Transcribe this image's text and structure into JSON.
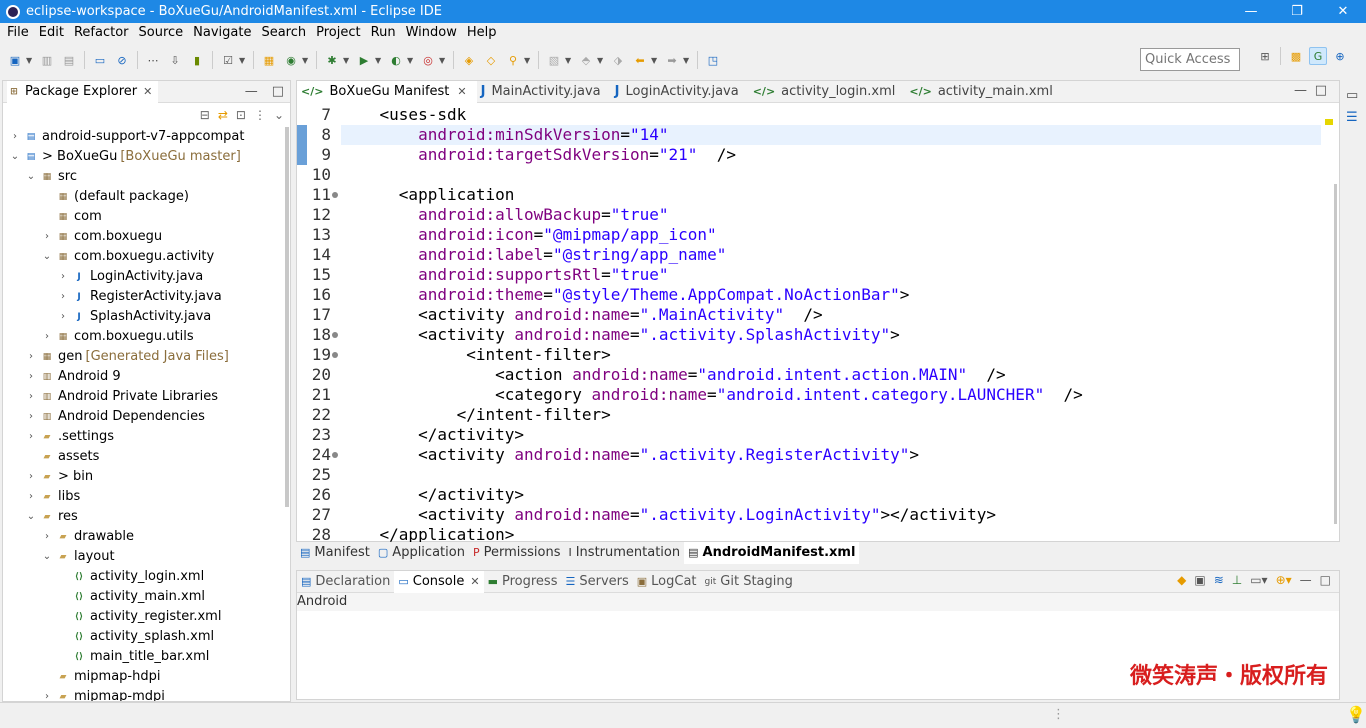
{
  "window": {
    "title": "eclipse-workspace - BoXueGu/AndroidManifest.xml - Eclipse IDE"
  },
  "menu": [
    "File",
    "Edit",
    "Refactor",
    "Source",
    "Navigate",
    "Search",
    "Project",
    "Run",
    "Window",
    "Help"
  ],
  "quick_access": {
    "placeholder": "Quick Access"
  },
  "package_explorer": {
    "tab_label": "Package Explorer",
    "tree": [
      {
        "label": "android-support-v7-appcompat",
        "deco": "",
        "depth": 0,
        "twisty": "closed",
        "icon": "project-icon"
      },
      {
        "label": "> BoXueGu",
        "deco": "[BoXueGu master]",
        "depth": 0,
        "twisty": "open",
        "icon": "project-icon"
      },
      {
        "label": "src",
        "deco": "",
        "depth": 1,
        "twisty": "open",
        "icon": "source-folder-icon"
      },
      {
        "label": "(default package)",
        "deco": "",
        "depth": 2,
        "twisty": "none",
        "icon": "package-icon"
      },
      {
        "label": "com",
        "deco": "",
        "depth": 2,
        "twisty": "none",
        "icon": "package-icon"
      },
      {
        "label": "com.boxuegu",
        "deco": "",
        "depth": 2,
        "twisty": "closed",
        "icon": "package-icon"
      },
      {
        "label": "com.boxuegu.activity",
        "deco": "",
        "depth": 2,
        "twisty": "open",
        "icon": "package-icon"
      },
      {
        "label": "LoginActivity.java",
        "deco": "",
        "depth": 3,
        "twisty": "closed",
        "icon": "java-file-icon"
      },
      {
        "label": "RegisterActivity.java",
        "deco": "",
        "depth": 3,
        "twisty": "closed",
        "icon": "java-file-icon"
      },
      {
        "label": "SplashActivity.java",
        "deco": "",
        "depth": 3,
        "twisty": "closed",
        "icon": "java-file-icon"
      },
      {
        "label": "com.boxuegu.utils",
        "deco": "",
        "depth": 2,
        "twisty": "closed",
        "icon": "package-icon"
      },
      {
        "label": "gen",
        "deco": "[Generated Java Files]",
        "depth": 1,
        "twisty": "closed",
        "icon": "source-folder-icon"
      },
      {
        "label": "Android 9",
        "deco": "",
        "depth": 1,
        "twisty": "closed",
        "icon": "library-icon"
      },
      {
        "label": "Android Private Libraries",
        "deco": "",
        "depth": 1,
        "twisty": "closed",
        "icon": "library-icon"
      },
      {
        "label": "Android Dependencies",
        "deco": "",
        "depth": 1,
        "twisty": "closed",
        "icon": "library-icon"
      },
      {
        "label": ".settings",
        "deco": "",
        "depth": 1,
        "twisty": "closed",
        "icon": "folder-icon"
      },
      {
        "label": "assets",
        "deco": "",
        "depth": 1,
        "twisty": "none",
        "icon": "folder-icon"
      },
      {
        "label": "> bin",
        "deco": "",
        "depth": 1,
        "twisty": "closed",
        "icon": "folder-icon"
      },
      {
        "label": "libs",
        "deco": "",
        "depth": 1,
        "twisty": "closed",
        "icon": "folder-icon"
      },
      {
        "label": "res",
        "deco": "",
        "depth": 1,
        "twisty": "open",
        "icon": "folder-icon"
      },
      {
        "label": "drawable",
        "deco": "",
        "depth": 2,
        "twisty": "closed",
        "icon": "folder-icon"
      },
      {
        "label": "layout",
        "deco": "",
        "depth": 2,
        "twisty": "open",
        "icon": "folder-icon"
      },
      {
        "label": "activity_login.xml",
        "deco": "",
        "depth": 3,
        "twisty": "none",
        "icon": "xml-file-icon"
      },
      {
        "label": "activity_main.xml",
        "deco": "",
        "depth": 3,
        "twisty": "none",
        "icon": "xml-file-icon"
      },
      {
        "label": "activity_register.xml",
        "deco": "",
        "depth": 3,
        "twisty": "none",
        "icon": "xml-file-icon"
      },
      {
        "label": "activity_splash.xml",
        "deco": "",
        "depth": 3,
        "twisty": "none",
        "icon": "xml-file-icon"
      },
      {
        "label": "main_title_bar.xml",
        "deco": "",
        "depth": 3,
        "twisty": "none",
        "icon": "xml-file-icon"
      },
      {
        "label": "mipmap-hdpi",
        "deco": "",
        "depth": 2,
        "twisty": "none",
        "icon": "folder-icon"
      },
      {
        "label": "mipmap-mdpi",
        "deco": "",
        "depth": 2,
        "twisty": "closed",
        "icon": "folder-icon"
      }
    ]
  },
  "editor_tabs": [
    {
      "label": "BoXueGu Manifest",
      "active": true,
      "icon": "xml-icon"
    },
    {
      "label": "MainActivity.java",
      "active": false,
      "icon": "java-icon"
    },
    {
      "label": "LoginActivity.java",
      "active": false,
      "icon": "java-icon"
    },
    {
      "label": "activity_login.xml",
      "active": false,
      "icon": "xml-icon"
    },
    {
      "label": "activity_main.xml",
      "active": false,
      "icon": "xml-icon"
    }
  ],
  "code_lines": [
    {
      "n": "7",
      "fold": false,
      "parts": [
        [
          "tg",
          "    <uses-sdk"
        ]
      ]
    },
    {
      "n": "8",
      "fold": false,
      "parts": [
        [
          "at",
          "        android:minSdkVersion"
        ],
        [
          "tg",
          "="
        ],
        [
          "sv",
          "\"14\""
        ]
      ]
    },
    {
      "n": "9",
      "fold": false,
      "parts": [
        [
          "at",
          "        android:targetSdkVersion"
        ],
        [
          "tg",
          "="
        ],
        [
          "sv",
          "\"21\""
        ],
        [
          "tg",
          "  />"
        ]
      ]
    },
    {
      "n": "10",
      "fold": false,
      "parts": [
        [
          "tg",
          ""
        ]
      ]
    },
    {
      "n": "11",
      "fold": true,
      "parts": [
        [
          "tg",
          "      <application"
        ]
      ]
    },
    {
      "n": "12",
      "fold": false,
      "parts": [
        [
          "at",
          "        android:allowBackup"
        ],
        [
          "tg",
          "="
        ],
        [
          "sv",
          "\"true\""
        ]
      ]
    },
    {
      "n": "13",
      "fold": false,
      "parts": [
        [
          "at",
          "        android:icon"
        ],
        [
          "tg",
          "="
        ],
        [
          "sv",
          "\"@mipmap/app_icon\""
        ]
      ]
    },
    {
      "n": "14",
      "fold": false,
      "parts": [
        [
          "at",
          "        android:label"
        ],
        [
          "tg",
          "="
        ],
        [
          "sv",
          "\"@string/app_name\""
        ]
      ]
    },
    {
      "n": "15",
      "fold": false,
      "parts": [
        [
          "at",
          "        android:supportsRtl"
        ],
        [
          "tg",
          "="
        ],
        [
          "sv",
          "\"true\""
        ]
      ]
    },
    {
      "n": "16",
      "fold": false,
      "parts": [
        [
          "at",
          "        android:theme"
        ],
        [
          "tg",
          "="
        ],
        [
          "sv",
          "\"@style/Theme.AppCompat.NoActionBar\""
        ],
        [
          "tg",
          ">"
        ]
      ]
    },
    {
      "n": "17",
      "fold": false,
      "parts": [
        [
          "tg",
          "        <activity "
        ],
        [
          "at",
          "android:name"
        ],
        [
          "tg",
          "="
        ],
        [
          "sv",
          "\".MainActivity\""
        ],
        [
          "tg",
          "  />"
        ]
      ]
    },
    {
      "n": "18",
      "fold": true,
      "parts": [
        [
          "tg",
          "        <activity "
        ],
        [
          "at",
          "android:name"
        ],
        [
          "tg",
          "="
        ],
        [
          "sv",
          "\".activity.SplashActivity\""
        ],
        [
          "tg",
          ">"
        ]
      ]
    },
    {
      "n": "19",
      "fold": true,
      "parts": [
        [
          "tg",
          "             <intent-filter>"
        ]
      ]
    },
    {
      "n": "20",
      "fold": false,
      "parts": [
        [
          "tg",
          "                <action "
        ],
        [
          "at",
          "android:name"
        ],
        [
          "tg",
          "="
        ],
        [
          "sv",
          "\"android.intent.action.MAIN\""
        ],
        [
          "tg",
          "  />"
        ]
      ]
    },
    {
      "n": "21",
      "fold": false,
      "parts": [
        [
          "tg",
          "                <category "
        ],
        [
          "at",
          "android:name"
        ],
        [
          "tg",
          "="
        ],
        [
          "sv",
          "\"android.intent.category.LAUNCHER\""
        ],
        [
          "tg",
          "  />"
        ]
      ]
    },
    {
      "n": "22",
      "fold": false,
      "parts": [
        [
          "tg",
          "            </intent-filter>"
        ]
      ]
    },
    {
      "n": "23",
      "fold": false,
      "parts": [
        [
          "tg",
          "        </activity>"
        ]
      ]
    },
    {
      "n": "24",
      "fold": true,
      "parts": [
        [
          "tg",
          "        <activity "
        ],
        [
          "at",
          "android:name"
        ],
        [
          "tg",
          "="
        ],
        [
          "sv",
          "\".activity.RegisterActivity\""
        ],
        [
          "tg",
          ">"
        ]
      ]
    },
    {
      "n": "25",
      "fold": false,
      "parts": [
        [
          "tg",
          ""
        ]
      ]
    },
    {
      "n": "26",
      "fold": false,
      "parts": [
        [
          "tg",
          "        </activity>"
        ]
      ]
    },
    {
      "n": "27",
      "fold": false,
      "parts": [
        [
          "tg",
          "        <activity "
        ],
        [
          "at",
          "android:name"
        ],
        [
          "tg",
          "="
        ],
        [
          "sv",
          "\".activity.LoginActivity\""
        ],
        [
          "tg",
          "></activity>"
        ]
      ]
    },
    {
      "n": "28",
      "fold": false,
      "parts": [
        [
          "tg",
          "    </application>"
        ]
      ]
    }
  ],
  "manifest_tabs": [
    {
      "label": "Manifest",
      "active": false
    },
    {
      "label": "Application",
      "active": false
    },
    {
      "label": "Permissions",
      "active": false
    },
    {
      "label": "Instrumentation",
      "active": false
    },
    {
      "label": "AndroidManifest.xml",
      "active": true
    }
  ],
  "console_tabs": [
    {
      "label": "Declaration",
      "active": false
    },
    {
      "label": "Console",
      "active": true
    },
    {
      "label": "Progress",
      "active": false
    },
    {
      "label": "Servers",
      "active": false
    },
    {
      "label": "LogCat",
      "active": false
    },
    {
      "label": "Git Staging",
      "active": false
    }
  ],
  "console": {
    "status": "Android"
  },
  "watermark": "微笑涛声・版权所有",
  "colors": {
    "titlebar": "#1e88e5",
    "attr": "#7f007f",
    "string": "#2a00ff",
    "current_line": "#e8f2fe",
    "watermark": "#d81e1e"
  }
}
